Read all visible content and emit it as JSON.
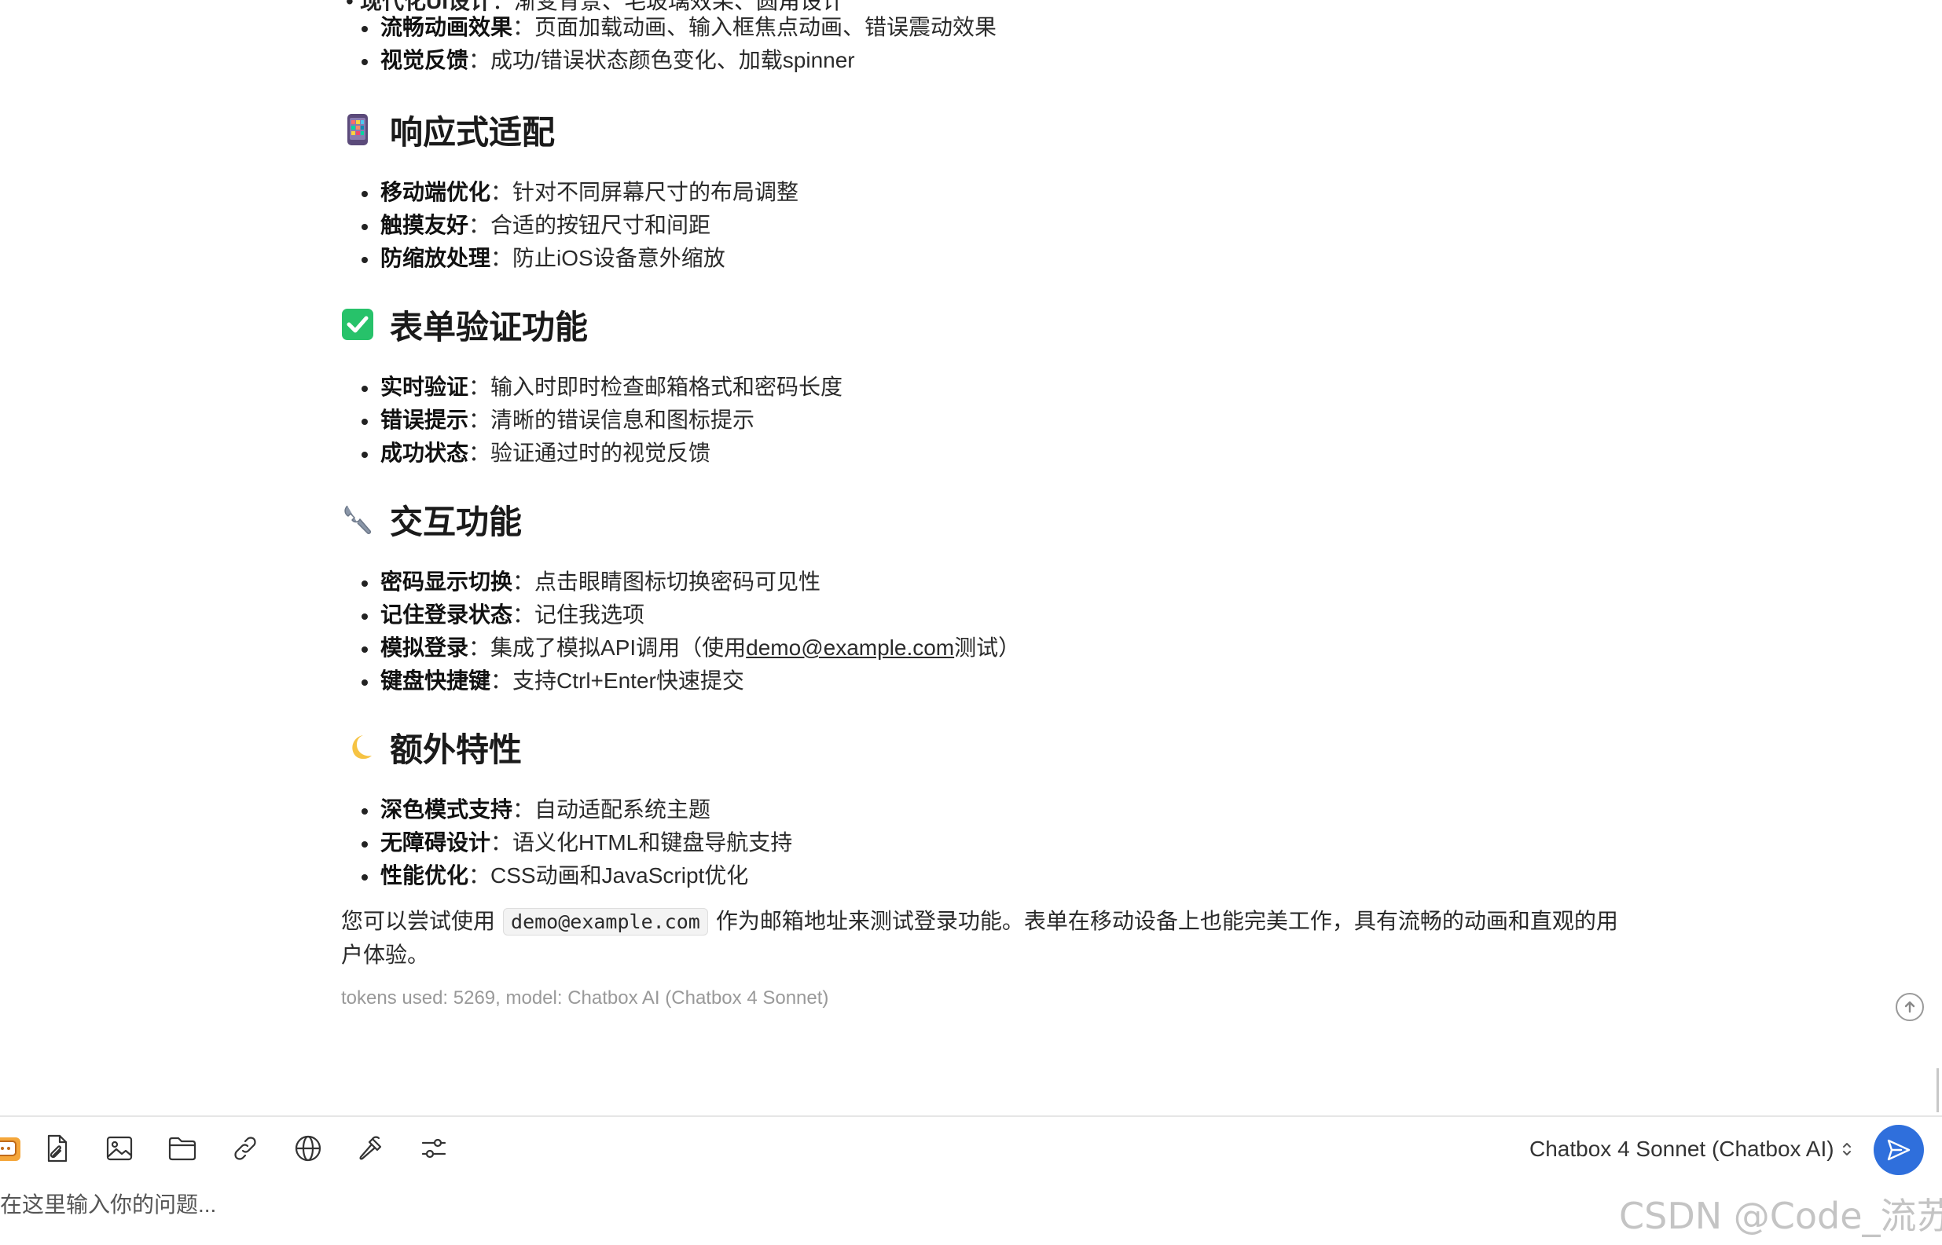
{
  "message": {
    "partial_item": {
      "label": "现代化UI设计",
      "text": "：渐变背景、毛玻璃效果、圆角设计"
    },
    "top_items": [
      {
        "label": "流畅动画效果",
        "text": "：页面加载动画、输入框焦点动画、错误震动效果"
      },
      {
        "label": "视觉反馈",
        "text": "：成功/错误状态颜色变化、加载spinner"
      }
    ],
    "sections": [
      {
        "icon": "mobile-phone-icon",
        "title": "响应式适配",
        "items": [
          {
            "label": "移动端优化",
            "text": "：针对不同屏幕尺寸的布局调整"
          },
          {
            "label": "触摸友好",
            "text": "：合适的按钮尺寸和间距"
          },
          {
            "label": "防缩放处理",
            "text": "：防止iOS设备意外缩放"
          }
        ]
      },
      {
        "icon": "check-mark-icon",
        "title": "表单验证功能",
        "items": [
          {
            "label": "实时验证",
            "text": "：输入时即时检查邮箱格式和密码长度"
          },
          {
            "label": "错误提示",
            "text": "：清晰的错误信息和图标提示"
          },
          {
            "label": "成功状态",
            "text": "：验证通过时的视觉反馈"
          }
        ]
      },
      {
        "icon": "wrench-icon",
        "title": "交互功能",
        "items": [
          {
            "label": "密码显示切换",
            "text": "：点击眼睛图标切换密码可见性"
          },
          {
            "label": "记住登录状态",
            "text": "：记住我选项"
          },
          {
            "label": "模拟登录",
            "text_before": "：集成了模拟API调用（使用",
            "link": "demo@example.com",
            "text_after": "测试）"
          },
          {
            "label": "键盘快捷键",
            "text": "：支持Ctrl+Enter快速提交"
          }
        ]
      },
      {
        "icon": "crescent-moon-icon",
        "title": "额外特性",
        "items": [
          {
            "label": "深色模式支持",
            "text": "：自动适配系统主题"
          },
          {
            "label": "无障碍设计",
            "text": "：语义化HTML和键盘导航支持"
          },
          {
            "label": "性能优化",
            "text": "：CSS动画和JavaScript优化"
          }
        ]
      }
    ],
    "closing_paragraph": {
      "before": "您可以尝试使用",
      "code": "demo@example.com",
      "after": "作为邮箱地址来测试登录功能。表单在移动设备上也能完美工作，具有流畅的动画和直观的用户体验。"
    },
    "meta": "tokens used: 5269, model: Chatbox AI (Chatbox 4 Sonnet)"
  },
  "toolbar": {
    "tools": [
      {
        "icon": "chatbox-app-icon"
      },
      {
        "icon": "attach-file-icon"
      },
      {
        "icon": "image-icon"
      },
      {
        "icon": "folder-icon"
      },
      {
        "icon": "link-icon"
      },
      {
        "icon": "globe-icon"
      },
      {
        "icon": "hammer-icon"
      },
      {
        "icon": "settings-sliders-icon"
      }
    ],
    "model_label": "Chatbox 4 Sonnet (Chatbox AI)",
    "send_icon": "send-icon"
  },
  "input": {
    "placeholder": "在这里输入你的问题..."
  },
  "watermark": "CSDN @Code_流苏",
  "colors": {
    "accent": "#2f6fdc",
    "check": "#27c26a",
    "moon": "#f6c343"
  }
}
